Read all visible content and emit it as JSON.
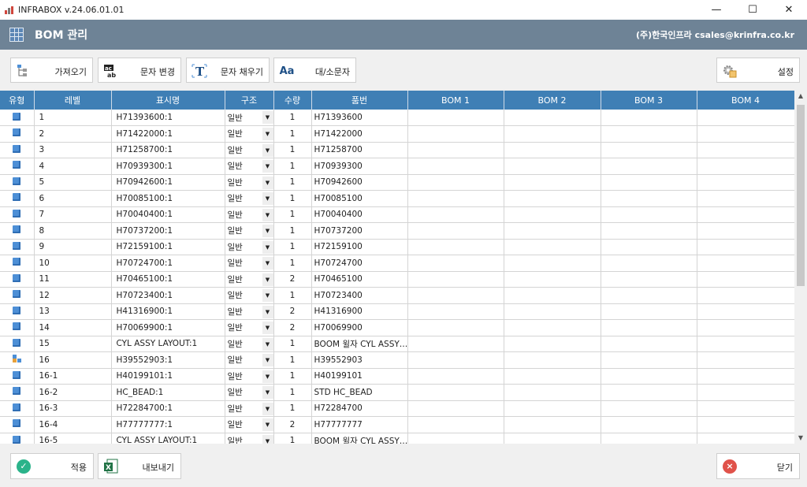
{
  "window": {
    "title": "INFRABOX  v.24.06.01.01",
    "minimize": "—",
    "maximize": "☐",
    "close": "✕"
  },
  "header": {
    "title": "BOM 관리",
    "company": "(주)한국인프라 csales@krinfra.co.kr"
  },
  "toolbar": {
    "import": "가져오기",
    "replace_text": "문자 변경",
    "fill_text": "문자 채우기",
    "case": "대/소문자",
    "settings": "설정"
  },
  "columns": [
    "유형",
    "레벨",
    "표시명",
    "구조",
    "수량",
    "품번",
    "BOM 1",
    "BOM 2",
    "BOM 3",
    "BOM 4"
  ],
  "rows": [
    {
      "type": "part",
      "level": "1",
      "display": "H71393600:1",
      "struct": "일반",
      "qty": "1",
      "partno": "H71393600"
    },
    {
      "type": "part",
      "level": "2",
      "display": "H71422000:1",
      "struct": "일반",
      "qty": "1",
      "partno": "H71422000"
    },
    {
      "type": "part",
      "level": "3",
      "display": "H71258700:1",
      "struct": "일반",
      "qty": "1",
      "partno": "H71258700"
    },
    {
      "type": "part",
      "level": "4",
      "display": "H70939300:1",
      "struct": "일반",
      "qty": "1",
      "partno": "H70939300"
    },
    {
      "type": "part",
      "level": "5",
      "display": "H70942600:1",
      "struct": "일반",
      "qty": "1",
      "partno": "H70942600"
    },
    {
      "type": "part",
      "level": "6",
      "display": "H70085100:1",
      "struct": "일반",
      "qty": "1",
      "partno": "H70085100"
    },
    {
      "type": "part",
      "level": "7",
      "display": "H70040400:1",
      "struct": "일반",
      "qty": "1",
      "partno": "H70040400"
    },
    {
      "type": "part",
      "level": "8",
      "display": "H70737200:1",
      "struct": "일반",
      "qty": "1",
      "partno": "H70737200"
    },
    {
      "type": "part",
      "level": "9",
      "display": "H72159100:1",
      "struct": "일반",
      "qty": "1",
      "partno": "H72159100"
    },
    {
      "type": "part",
      "level": "10",
      "display": "H70724700:1",
      "struct": "일반",
      "qty": "1",
      "partno": "H70724700"
    },
    {
      "type": "part",
      "level": "11",
      "display": "H70465100:1",
      "struct": "일반",
      "qty": "2",
      "partno": "H70465100"
    },
    {
      "type": "part",
      "level": "12",
      "display": "H70723400:1",
      "struct": "일반",
      "qty": "1",
      "partno": "H70723400"
    },
    {
      "type": "part",
      "level": "13",
      "display": "H41316900:1",
      "struct": "일반",
      "qty": "2",
      "partno": "H41316900"
    },
    {
      "type": "part",
      "level": "14",
      "display": "H70069900:1",
      "struct": "일반",
      "qty": "2",
      "partno": "H70069900"
    },
    {
      "type": "part",
      "level": "15",
      "display": "CYL ASSY LAYOUT:1",
      "struct": "일반",
      "qty": "1",
      "partno": "BOOM 윌자 CYL ASSY…"
    },
    {
      "type": "assembly",
      "level": "16",
      "display": "H39552903:1",
      "struct": "일반",
      "qty": "1",
      "partno": "H39552903"
    },
    {
      "type": "part",
      "level": "16-1",
      "display": "H40199101:1",
      "struct": "일반",
      "qty": "1",
      "partno": "H40199101"
    },
    {
      "type": "part",
      "level": "16-2",
      "display": "HC_BEAD:1",
      "struct": "일반",
      "qty": "1",
      "partno": "STD HC_BEAD"
    },
    {
      "type": "part",
      "level": "16-3",
      "display": "H72284700:1",
      "struct": "일반",
      "qty": "1",
      "partno": "H72284700"
    },
    {
      "type": "part",
      "level": "16-4",
      "display": "H77777777:1",
      "struct": "일반",
      "qty": "2",
      "partno": "H77777777"
    },
    {
      "type": "part",
      "level": "16-5",
      "display": "CYL ASSY LAYOUT:1",
      "struct": "일반",
      "qty": "1",
      "partno": "BOOM 윌자 CYL ASSY…"
    }
  ],
  "footer": {
    "apply": "적용",
    "export": "내보내기",
    "close": "닫기"
  }
}
